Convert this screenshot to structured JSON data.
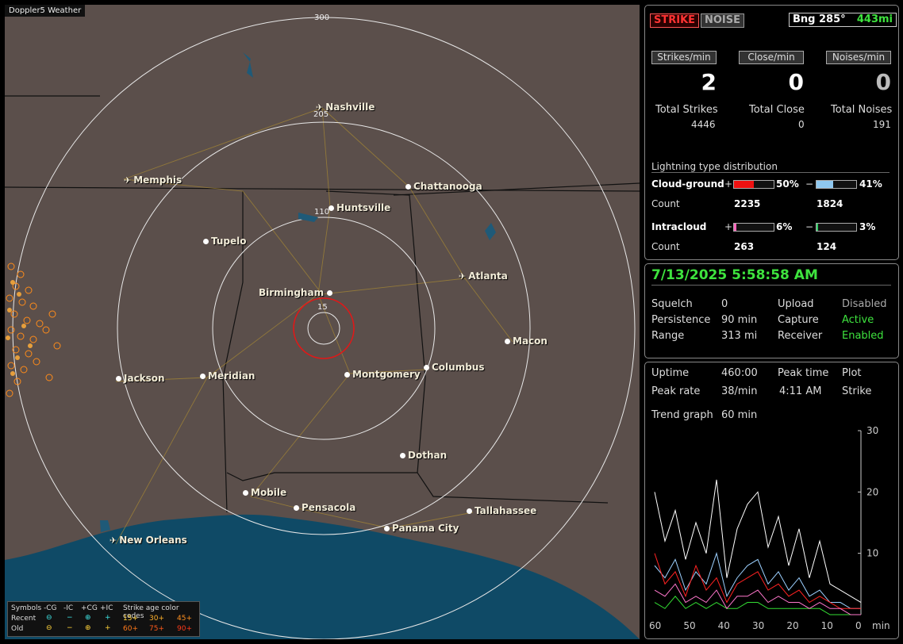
{
  "app": {
    "title": "Doppler5 Weather"
  },
  "map": {
    "ring_labels": {
      "r300": "300",
      "r205": "205",
      "r110": "110",
      "r15": "15"
    },
    "cities": {
      "nashville": "Nashville",
      "memphis": "Memphis",
      "chattanooga": "Chattanooga",
      "huntsville": "Huntsville",
      "tupelo": "Tupelo",
      "birmingham": "Birmingham",
      "atlanta": "Atlanta",
      "macon": "Macon",
      "jackson": "Jackson",
      "meridian": "Meridian",
      "montgomery": "Montgomery",
      "columbus": "Columbus",
      "dothan": "Dothan",
      "mobile": "Mobile",
      "pensacola": "Pensacola",
      "tallahassee": "Tallahassee",
      "panama_city": "Panama City",
      "new_orleans": "New Orleans"
    },
    "legend": {
      "symbols": "Symbols",
      "neg_cg": "-CG",
      "neg_ic": "-IC",
      "pos_cg": "+CG",
      "pos_ic": "+IC",
      "age_title": "Strike age color codes",
      "recent": "Recent",
      "old": "Old",
      "r15": "15+",
      "r30": "30+",
      "r45": "45+",
      "o60": "60+",
      "o75": "75+",
      "o90": "90+"
    }
  },
  "counts": {
    "strike_btn": "STRIKE",
    "noise_btn": "NOISE",
    "bearing": "Bng 285°",
    "distance": "443mi",
    "strikes_min_label": "Strikes/min",
    "close_min_label": "Close/min",
    "noises_min_label": "Noises/min",
    "strikes_min": "2",
    "close_min": "0",
    "noises_min": "0",
    "total_strikes_label": "Total Strikes",
    "total_close_label": "Total Close",
    "total_noises_label": "Total Noises",
    "total_strikes": "4446",
    "total_close": "0",
    "total_noises": "191"
  },
  "distribution": {
    "title": "Lightning type distribution",
    "cg_label": "Cloud-ground",
    "ic_label": "Intracloud",
    "count_label": "Count",
    "plus": "+",
    "minus": "−",
    "cg_pos_pct": "50%",
    "cg_neg_pct": "41%",
    "ic_pos_pct": "6%",
    "ic_neg_pct": "3%",
    "cg_pos_fill": 0.5,
    "cg_neg_fill": 0.41,
    "ic_pos_fill": 0.06,
    "ic_neg_fill": 0.03,
    "cg_pos_count": "2235",
    "cg_neg_count": "1824",
    "ic_pos_count": "263",
    "ic_neg_count": "124"
  },
  "status": {
    "datetime": "7/13/2025 5:58:58 AM",
    "squelch_label": "Squelch",
    "squelch": "0",
    "persistence_label": "Persistence",
    "persistence": "90 min",
    "range_label": "Range",
    "range": "313 mi",
    "upload_label": "Upload",
    "upload": "Disabled",
    "capture_label": "Capture",
    "capture": "Active",
    "receiver_label": "Receiver",
    "receiver": "Enabled"
  },
  "stats": {
    "uptime_label": "Uptime",
    "uptime": "460:00",
    "peak_time_label": "Peak time",
    "peak_time": "4:11 AM",
    "plot_label": "Plot",
    "plot": "Strike",
    "peak_rate_label": "Peak rate",
    "peak_rate": "38/min",
    "trend_label": "Trend graph",
    "trend": "60 min"
  },
  "chart_data": {
    "type": "line",
    "xlabel": "min",
    "x_ticks": [
      "60",
      "50",
      "40",
      "30",
      "20",
      "10",
      "0"
    ],
    "y_ticks": [
      "30",
      "20",
      "10"
    ],
    "xlim": [
      60,
      0
    ],
    "ylim": [
      0,
      30
    ],
    "x": [
      60,
      57,
      54,
      51,
      48,
      45,
      42,
      39,
      36,
      33,
      30,
      27,
      24,
      21,
      18,
      15,
      12,
      9,
      6,
      3,
      0
    ],
    "series": [
      {
        "color": "#ffffff",
        "values": [
          20,
          12,
          17,
          9,
          15,
          10,
          22,
          6,
          14,
          18,
          20,
          11,
          16,
          8,
          14,
          6,
          12,
          5,
          4,
          3,
          2
        ]
      },
      {
        "color": "#9cd0ff",
        "values": [
          8,
          6,
          9,
          4,
          7,
          5,
          10,
          3,
          6,
          8,
          9,
          5,
          7,
          4,
          6,
          3,
          4,
          2,
          2,
          1,
          1
        ]
      },
      {
        "color": "#ff2222",
        "values": [
          10,
          5,
          7,
          3,
          8,
          4,
          6,
          2,
          5,
          6,
          7,
          4,
          5,
          3,
          4,
          2,
          3,
          2,
          1,
          1,
          1
        ]
      },
      {
        "color": "#33dd33",
        "values": [
          2,
          1,
          3,
          1,
          2,
          1,
          2,
          1,
          1,
          2,
          2,
          1,
          1,
          1,
          1,
          1,
          1,
          0,
          0,
          0,
          0
        ]
      },
      {
        "color": "#ff77cc",
        "values": [
          4,
          3,
          5,
          2,
          3,
          2,
          4,
          1,
          3,
          3,
          4,
          2,
          3,
          2,
          2,
          1,
          2,
          1,
          1,
          0,
          0
        ]
      }
    ]
  }
}
